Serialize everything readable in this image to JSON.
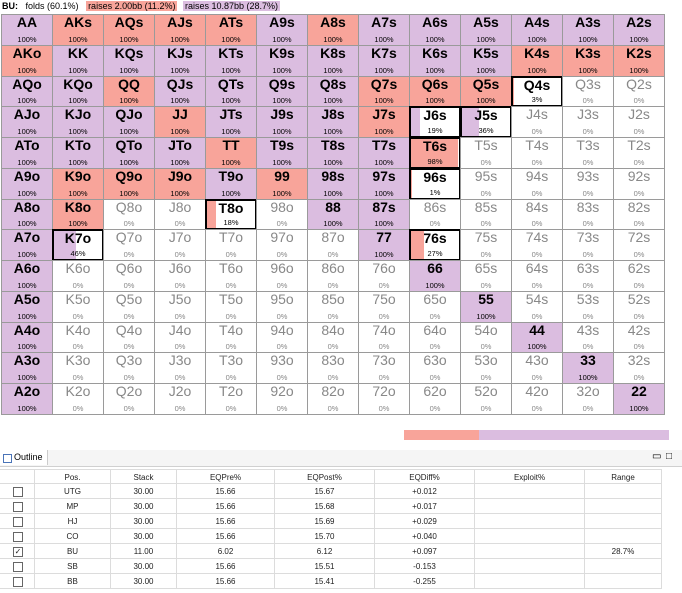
{
  "legend": {
    "position": "BU:",
    "tags": [
      {
        "label": "folds (60.1%)",
        "color": "#ffffff"
      },
      {
        "label": "raises 2.00bb (11.2%)",
        "color": "#f8a49a"
      },
      {
        "label": "raises 10.87bb (28.7%)",
        "color": "#dbbde0"
      }
    ]
  },
  "colors": {
    "raise_small": "#f8a49a",
    "raise_big": "#dbbde0",
    "fold": "#ffffff"
  },
  "grid": {
    "rows": [
      [
        {
          "h": "AA",
          "p": "100%",
          "r": 0,
          "b": 100
        },
        {
          "h": "AKs",
          "p": "100%",
          "r": 100,
          "b": 0
        },
        {
          "h": "AQs",
          "p": "100%",
          "r": 100,
          "b": 0
        },
        {
          "h": "AJs",
          "p": "100%",
          "r": 100,
          "b": 0
        },
        {
          "h": "ATs",
          "p": "100%",
          "r": 100,
          "b": 0
        },
        {
          "h": "A9s",
          "p": "100%",
          "r": 0,
          "b": 100
        },
        {
          "h": "A8s",
          "p": "100%",
          "r": 100,
          "b": 0
        },
        {
          "h": "A7s",
          "p": "100%",
          "r": 0,
          "b": 100
        },
        {
          "h": "A6s",
          "p": "100%",
          "r": 0,
          "b": 100
        },
        {
          "h": "A5s",
          "p": "100%",
          "r": 0,
          "b": 100
        },
        {
          "h": "A4s",
          "p": "100%",
          "r": 0,
          "b": 100
        },
        {
          "h": "A3s",
          "p": "100%",
          "r": 0,
          "b": 100
        },
        {
          "h": "A2s",
          "p": "100%",
          "r": 0,
          "b": 100
        }
      ],
      [
        {
          "h": "AKo",
          "p": "100%",
          "r": 100,
          "b": 0
        },
        {
          "h": "KK",
          "p": "100%",
          "r": 0,
          "b": 100
        },
        {
          "h": "KQs",
          "p": "100%",
          "r": 0,
          "b": 100
        },
        {
          "h": "KJs",
          "p": "100%",
          "r": 0,
          "b": 100
        },
        {
          "h": "KTs",
          "p": "100%",
          "r": 0,
          "b": 100
        },
        {
          "h": "K9s",
          "p": "100%",
          "r": 0,
          "b": 100
        },
        {
          "h": "K8s",
          "p": "100%",
          "r": 0,
          "b": 100
        },
        {
          "h": "K7s",
          "p": "100%",
          "r": 0,
          "b": 100
        },
        {
          "h": "K6s",
          "p": "100%",
          "r": 0,
          "b": 100
        },
        {
          "h": "K5s",
          "p": "100%",
          "r": 0,
          "b": 100
        },
        {
          "h": "K4s",
          "p": "100%",
          "r": 100,
          "b": 0
        },
        {
          "h": "K3s",
          "p": "100%",
          "r": 100,
          "b": 0
        },
        {
          "h": "K2s",
          "p": "100%",
          "r": 100,
          "b": 0
        }
      ],
      [
        {
          "h": "AQo",
          "p": "100%",
          "r": 0,
          "b": 100
        },
        {
          "h": "KQo",
          "p": "100%",
          "r": 0,
          "b": 100
        },
        {
          "h": "QQ",
          "p": "100%",
          "r": 100,
          "b": 0
        },
        {
          "h": "QJs",
          "p": "100%",
          "r": 0,
          "b": 100
        },
        {
          "h": "QTs",
          "p": "100%",
          "r": 0,
          "b": 100
        },
        {
          "h": "Q9s",
          "p": "100%",
          "r": 0,
          "b": 100
        },
        {
          "h": "Q8s",
          "p": "100%",
          "r": 0,
          "b": 100
        },
        {
          "h": "Q7s",
          "p": "100%",
          "r": 100,
          "b": 0
        },
        {
          "h": "Q6s",
          "p": "100%",
          "r": 100,
          "b": 0
        },
        {
          "h": "Q5s",
          "p": "100%",
          "r": 100,
          "b": 0
        },
        {
          "h": "Q4s",
          "p": "3%",
          "r": 3,
          "b": 0
        },
        {
          "h": "Q3s",
          "p": "0%",
          "r": 0,
          "b": 0
        },
        {
          "h": "Q2s",
          "p": "0%",
          "r": 0,
          "b": 0
        }
      ],
      [
        {
          "h": "AJo",
          "p": "100%",
          "r": 0,
          "b": 100
        },
        {
          "h": "KJo",
          "p": "100%",
          "r": 0,
          "b": 100
        },
        {
          "h": "QJo",
          "p": "100%",
          "r": 0,
          "b": 100
        },
        {
          "h": "JJ",
          "p": "100%",
          "r": 100,
          "b": 0
        },
        {
          "h": "JTs",
          "p": "100%",
          "r": 0,
          "b": 100
        },
        {
          "h": "J9s",
          "p": "100%",
          "r": 0,
          "b": 100
        },
        {
          "h": "J8s",
          "p": "100%",
          "r": 0,
          "b": 100
        },
        {
          "h": "J7s",
          "p": "100%",
          "r": 100,
          "b": 0
        },
        {
          "h": "J6s",
          "p": "19%",
          "r": 0,
          "b": 19
        },
        {
          "h": "J5s",
          "p": "36%",
          "r": 0,
          "b": 36
        },
        {
          "h": "J4s",
          "p": "0%",
          "r": 0,
          "b": 0
        },
        {
          "h": "J3s",
          "p": "0%",
          "r": 0,
          "b": 0
        },
        {
          "h": "J2s",
          "p": "0%",
          "r": 0,
          "b": 0
        }
      ],
      [
        {
          "h": "ATo",
          "p": "100%",
          "r": 0,
          "b": 100
        },
        {
          "h": "KTo",
          "p": "100%",
          "r": 0,
          "b": 100
        },
        {
          "h": "QTo",
          "p": "100%",
          "r": 0,
          "b": 100
        },
        {
          "h": "JTo",
          "p": "100%",
          "r": 0,
          "b": 100
        },
        {
          "h": "TT",
          "p": "100%",
          "r": 100,
          "b": 0
        },
        {
          "h": "T9s",
          "p": "100%",
          "r": 0,
          "b": 100
        },
        {
          "h": "T8s",
          "p": "100%",
          "r": 0,
          "b": 100
        },
        {
          "h": "T7s",
          "p": "100%",
          "r": 0,
          "b": 100
        },
        {
          "h": "T6s",
          "p": "98%",
          "r": 98,
          "b": 0
        },
        {
          "h": "T5s",
          "p": "0%",
          "r": 0,
          "b": 0
        },
        {
          "h": "T4s",
          "p": "0%",
          "r": 0,
          "b": 0
        },
        {
          "h": "T3s",
          "p": "0%",
          "r": 0,
          "b": 0
        },
        {
          "h": "T2s",
          "p": "0%",
          "r": 0,
          "b": 0
        }
      ],
      [
        {
          "h": "A9o",
          "p": "100%",
          "r": 0,
          "b": 100
        },
        {
          "h": "K9o",
          "p": "100%",
          "r": 100,
          "b": 0
        },
        {
          "h": "Q9o",
          "p": "100%",
          "r": 100,
          "b": 0
        },
        {
          "h": "J9o",
          "p": "100%",
          "r": 100,
          "b": 0
        },
        {
          "h": "T9o",
          "p": "100%",
          "r": 0,
          "b": 100
        },
        {
          "h": "99",
          "p": "100%",
          "r": 100,
          "b": 0
        },
        {
          "h": "98s",
          "p": "100%",
          "r": 0,
          "b": 100
        },
        {
          "h": "97s",
          "p": "100%",
          "r": 0,
          "b": 100
        },
        {
          "h": "96s",
          "p": "1%",
          "r": 1,
          "b": 0
        },
        {
          "h": "95s",
          "p": "0%",
          "r": 0,
          "b": 0
        },
        {
          "h": "94s",
          "p": "0%",
          "r": 0,
          "b": 0
        },
        {
          "h": "93s",
          "p": "0%",
          "r": 0,
          "b": 0
        },
        {
          "h": "92s",
          "p": "0%",
          "r": 0,
          "b": 0
        }
      ],
      [
        {
          "h": "A8o",
          "p": "100%",
          "r": 0,
          "b": 100
        },
        {
          "h": "K8o",
          "p": "100%",
          "r": 100,
          "b": 0
        },
        {
          "h": "Q8o",
          "p": "0%",
          "r": 0,
          "b": 0
        },
        {
          "h": "J8o",
          "p": "0%",
          "r": 0,
          "b": 0
        },
        {
          "h": "T8o",
          "p": "18%",
          "r": 18,
          "b": 0
        },
        {
          "h": "98o",
          "p": "0%",
          "r": 0,
          "b": 0
        },
        {
          "h": "88",
          "p": "100%",
          "r": 0,
          "b": 100
        },
        {
          "h": "87s",
          "p": "100%",
          "r": 0,
          "b": 100
        },
        {
          "h": "86s",
          "p": "0%",
          "r": 0,
          "b": 0
        },
        {
          "h": "85s",
          "p": "0%",
          "r": 0,
          "b": 0
        },
        {
          "h": "84s",
          "p": "0%",
          "r": 0,
          "b": 0
        },
        {
          "h": "83s",
          "p": "0%",
          "r": 0,
          "b": 0
        },
        {
          "h": "82s",
          "p": "0%",
          "r": 0,
          "b": 0
        }
      ],
      [
        {
          "h": "A7o",
          "p": "100%",
          "r": 0,
          "b": 100
        },
        {
          "h": "K7o",
          "p": "46%",
          "r": 0,
          "b": 46
        },
        {
          "h": "Q7o",
          "p": "0%",
          "r": 0,
          "b": 0
        },
        {
          "h": "J7o",
          "p": "0%",
          "r": 0,
          "b": 0
        },
        {
          "h": "T7o",
          "p": "0%",
          "r": 0,
          "b": 0
        },
        {
          "h": "97o",
          "p": "0%",
          "r": 0,
          "b": 0
        },
        {
          "h": "87o",
          "p": "0%",
          "r": 0,
          "b": 0
        },
        {
          "h": "77",
          "p": "100%",
          "r": 0,
          "b": 100
        },
        {
          "h": "76s",
          "p": "27%",
          "r": 27,
          "b": 0
        },
        {
          "h": "75s",
          "p": "0%",
          "r": 0,
          "b": 0
        },
        {
          "h": "74s",
          "p": "0%",
          "r": 0,
          "b": 0
        },
        {
          "h": "73s",
          "p": "0%",
          "r": 0,
          "b": 0
        },
        {
          "h": "72s",
          "p": "0%",
          "r": 0,
          "b": 0
        }
      ],
      [
        {
          "h": "A6o",
          "p": "100%",
          "r": 0,
          "b": 100
        },
        {
          "h": "K6o",
          "p": "0%",
          "r": 0,
          "b": 0
        },
        {
          "h": "Q6o",
          "p": "0%",
          "r": 0,
          "b": 0
        },
        {
          "h": "J6o",
          "p": "0%",
          "r": 0,
          "b": 0
        },
        {
          "h": "T6o",
          "p": "0%",
          "r": 0,
          "b": 0
        },
        {
          "h": "96o",
          "p": "0%",
          "r": 0,
          "b": 0
        },
        {
          "h": "86o",
          "p": "0%",
          "r": 0,
          "b": 0
        },
        {
          "h": "76o",
          "p": "0%",
          "r": 0,
          "b": 0
        },
        {
          "h": "66",
          "p": "100%",
          "r": 0,
          "b": 100
        },
        {
          "h": "65s",
          "p": "0%",
          "r": 0,
          "b": 0
        },
        {
          "h": "64s",
          "p": "0%",
          "r": 0,
          "b": 0
        },
        {
          "h": "63s",
          "p": "0%",
          "r": 0,
          "b": 0
        },
        {
          "h": "62s",
          "p": "0%",
          "r": 0,
          "b": 0
        }
      ],
      [
        {
          "h": "A5o",
          "p": "100%",
          "r": 0,
          "b": 100
        },
        {
          "h": "K5o",
          "p": "0%",
          "r": 0,
          "b": 0
        },
        {
          "h": "Q5o",
          "p": "0%",
          "r": 0,
          "b": 0
        },
        {
          "h": "J5o",
          "p": "0%",
          "r": 0,
          "b": 0
        },
        {
          "h": "T5o",
          "p": "0%",
          "r": 0,
          "b": 0
        },
        {
          "h": "95o",
          "p": "0%",
          "r": 0,
          "b": 0
        },
        {
          "h": "85o",
          "p": "0%",
          "r": 0,
          "b": 0
        },
        {
          "h": "75o",
          "p": "0%",
          "r": 0,
          "b": 0
        },
        {
          "h": "65o",
          "p": "0%",
          "r": 0,
          "b": 0
        },
        {
          "h": "55",
          "p": "100%",
          "r": 0,
          "b": 100
        },
        {
          "h": "54s",
          "p": "0%",
          "r": 0,
          "b": 0
        },
        {
          "h": "53s",
          "p": "0%",
          "r": 0,
          "b": 0
        },
        {
          "h": "52s",
          "p": "0%",
          "r": 0,
          "b": 0
        }
      ],
      [
        {
          "h": "A4o",
          "p": "100%",
          "r": 0,
          "b": 100
        },
        {
          "h": "K4o",
          "p": "0%",
          "r": 0,
          "b": 0
        },
        {
          "h": "Q4o",
          "p": "0%",
          "r": 0,
          "b": 0
        },
        {
          "h": "J4o",
          "p": "0%",
          "r": 0,
          "b": 0
        },
        {
          "h": "T4o",
          "p": "0%",
          "r": 0,
          "b": 0
        },
        {
          "h": "94o",
          "p": "0%",
          "r": 0,
          "b": 0
        },
        {
          "h": "84o",
          "p": "0%",
          "r": 0,
          "b": 0
        },
        {
          "h": "74o",
          "p": "0%",
          "r": 0,
          "b": 0
        },
        {
          "h": "64o",
          "p": "0%",
          "r": 0,
          "b": 0
        },
        {
          "h": "54o",
          "p": "0%",
          "r": 0,
          "b": 0
        },
        {
          "h": "44",
          "p": "100%",
          "r": 0,
          "b": 100
        },
        {
          "h": "43s",
          "p": "0%",
          "r": 0,
          "b": 0
        },
        {
          "h": "42s",
          "p": "0%",
          "r": 0,
          "b": 0
        }
      ],
      [
        {
          "h": "A3o",
          "p": "100%",
          "r": 0,
          "b": 100
        },
        {
          "h": "K3o",
          "p": "0%",
          "r": 0,
          "b": 0
        },
        {
          "h": "Q3o",
          "p": "0%",
          "r": 0,
          "b": 0
        },
        {
          "h": "J3o",
          "p": "0%",
          "r": 0,
          "b": 0
        },
        {
          "h": "T3o",
          "p": "0%",
          "r": 0,
          "b": 0
        },
        {
          "h": "93o",
          "p": "0%",
          "r": 0,
          "b": 0
        },
        {
          "h": "83o",
          "p": "0%",
          "r": 0,
          "b": 0
        },
        {
          "h": "73o",
          "p": "0%",
          "r": 0,
          "b": 0
        },
        {
          "h": "63o",
          "p": "0%",
          "r": 0,
          "b": 0
        },
        {
          "h": "53o",
          "p": "0%",
          "r": 0,
          "b": 0
        },
        {
          "h": "43o",
          "p": "0%",
          "r": 0,
          "b": 0
        },
        {
          "h": "33",
          "p": "100%",
          "r": 0,
          "b": 100
        },
        {
          "h": "32s",
          "p": "0%",
          "r": 0,
          "b": 0
        }
      ],
      [
        {
          "h": "A2o",
          "p": "100%",
          "r": 0,
          "b": 100
        },
        {
          "h": "K2o",
          "p": "0%",
          "r": 0,
          "b": 0
        },
        {
          "h": "Q2o",
          "p": "0%",
          "r": 0,
          "b": 0
        },
        {
          "h": "J2o",
          "p": "0%",
          "r": 0,
          "b": 0
        },
        {
          "h": "T2o",
          "p": "0%",
          "r": 0,
          "b": 0
        },
        {
          "h": "92o",
          "p": "0%",
          "r": 0,
          "b": 0
        },
        {
          "h": "82o",
          "p": "0%",
          "r": 0,
          "b": 0
        },
        {
          "h": "72o",
          "p": "0%",
          "r": 0,
          "b": 0
        },
        {
          "h": "62o",
          "p": "0%",
          "r": 0,
          "b": 0
        },
        {
          "h": "52o",
          "p": "0%",
          "r": 0,
          "b": 0
        },
        {
          "h": "42o",
          "p": "0%",
          "r": 0,
          "b": 0
        },
        {
          "h": "32o",
          "p": "0%",
          "r": 0,
          "b": 0
        },
        {
          "h": "22",
          "p": "100%",
          "r": 0,
          "b": 100
        }
      ]
    ]
  },
  "summary_bar": {
    "fold": 60.1,
    "raise_small": 11.2,
    "raise_big": 28.7
  },
  "outline": {
    "tab_label": "Outline",
    "min_icon": "minimize-icon",
    "max_icon": "maximize-icon",
    "columns": [
      "",
      "Pos.",
      "Stack",
      "EQPre%",
      "EQPost%",
      "EQDiff%",
      "Exploit%",
      "Range"
    ],
    "rows": [
      {
        "checked": false,
        "pos": "UTG",
        "stack": "30.00",
        "eqpre": "15.66",
        "eqpost": "15.67",
        "eqdiff": "+0.012",
        "exploit": "",
        "range": ""
      },
      {
        "checked": false,
        "pos": "MP",
        "stack": "30.00",
        "eqpre": "15.66",
        "eqpost": "15.68",
        "eqdiff": "+0.017",
        "exploit": "",
        "range": ""
      },
      {
        "checked": false,
        "pos": "HJ",
        "stack": "30.00",
        "eqpre": "15.66",
        "eqpost": "15.69",
        "eqdiff": "+0.029",
        "exploit": "",
        "range": ""
      },
      {
        "checked": false,
        "pos": "CO",
        "stack": "30.00",
        "eqpre": "15.66",
        "eqpost": "15.70",
        "eqdiff": "+0.040",
        "exploit": "",
        "range": ""
      },
      {
        "checked": true,
        "pos": "BU",
        "stack": "11.00",
        "eqpre": "6.02",
        "eqpost": "6.12",
        "eqdiff": "+0.097",
        "exploit": "",
        "range": "28.7%"
      },
      {
        "checked": false,
        "pos": "SB",
        "stack": "30.00",
        "eqpre": "15.66",
        "eqpost": "15.51",
        "eqdiff": "-0.153",
        "exploit": "",
        "range": ""
      },
      {
        "checked": false,
        "pos": "BB",
        "stack": "30.00",
        "eqpre": "15.66",
        "eqpost": "15.41",
        "eqdiff": "-0.255",
        "exploit": "",
        "range": ""
      }
    ]
  }
}
